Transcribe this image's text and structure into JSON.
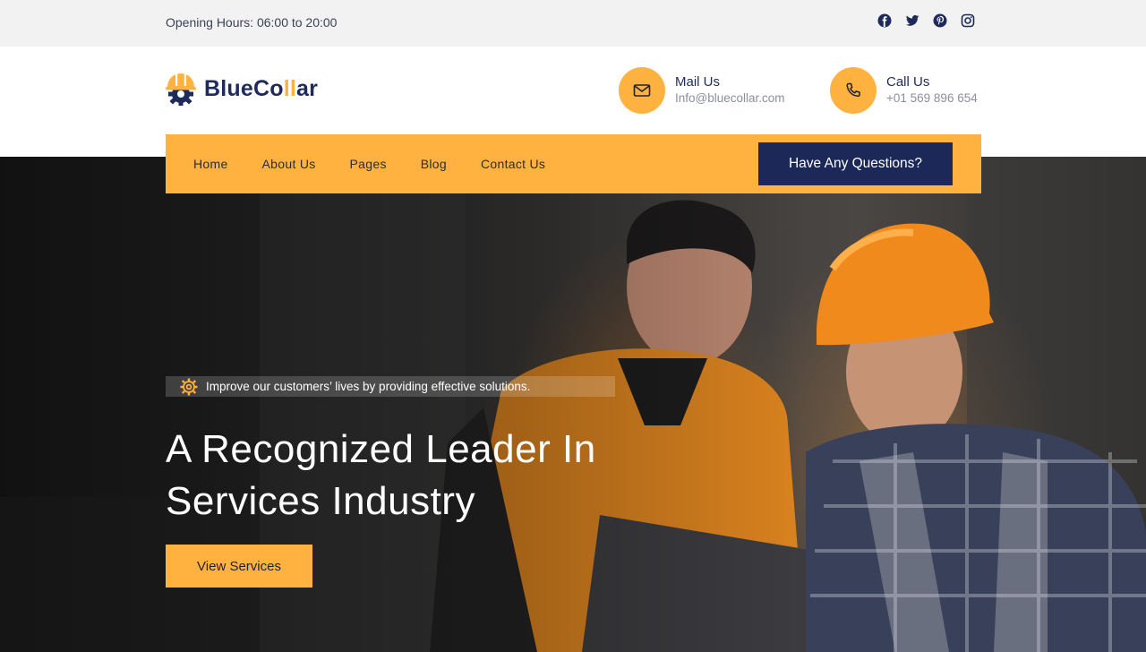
{
  "topbar": {
    "hours": "Opening Hours: 06:00 to 20:00",
    "socials": [
      "facebook-icon",
      "twitter-icon",
      "pinterest-icon",
      "instagram-icon"
    ]
  },
  "header": {
    "logo": {
      "part1": "BlueCo",
      "part2": "ll",
      "part3": "ar",
      "icon": "helmet-gear-icon"
    },
    "mail": {
      "title": "Mail Us",
      "value": "Info@bluecollar.com",
      "icon": "envelope-icon"
    },
    "call": {
      "title": "Call Us",
      "value": "+01 569 896 654",
      "icon": "phone-icon"
    }
  },
  "nav": {
    "items": [
      "Home",
      "About Us",
      "Pages",
      "Blog",
      "Contact Us"
    ],
    "cta": "Have Any Questions?"
  },
  "hero": {
    "tagline": "Improve our customers’ lives by providing effective solutions.",
    "tagline_icon": "gear-icon",
    "headline_line1": "A Recognized Leader In",
    "headline_line2": "Services Industry",
    "button": "View Services"
  },
  "colors": {
    "accent": "#ffb23f",
    "navy": "#1b2858",
    "topbar_bg": "#f2f2f2"
  }
}
